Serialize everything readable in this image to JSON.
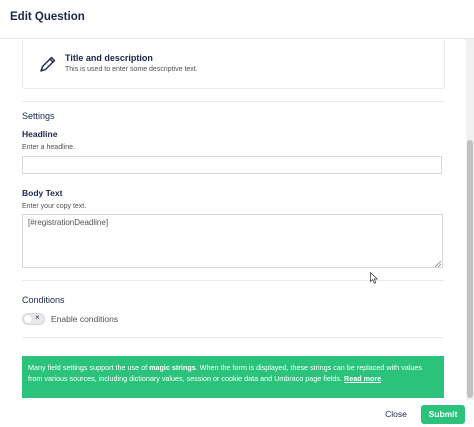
{
  "header": {
    "title": "Edit Question"
  },
  "field_type": {
    "icon": "pencil-icon",
    "title": "Title and description",
    "description": "This is used to enter some descriptive text."
  },
  "settings": {
    "title": "Settings",
    "headline": {
      "label": "Headline",
      "description": "Enter a headline.",
      "value": ""
    },
    "body_text": {
      "label": "Body Text",
      "description": "Enter your copy text.",
      "value": "[#registrationDeadline]"
    }
  },
  "conditions": {
    "title": "Conditions",
    "toggle_label": "Enable conditions",
    "enabled": false,
    "toggle_glyph": "×"
  },
  "info": {
    "text_before": "Many field settings support the use of ",
    "highlight": "magic strings",
    "text_after": ". When the form is displayed, these strings can be replaced with values from various sources, including dictionary values, session or cookie data and Umbraco page fields. ",
    "link": "Read more",
    "tail": "."
  },
  "footer": {
    "close_label": "Close",
    "submit_label": "Submit"
  },
  "colors": {
    "accent": "#2bc37c",
    "text": "#1b264f"
  }
}
